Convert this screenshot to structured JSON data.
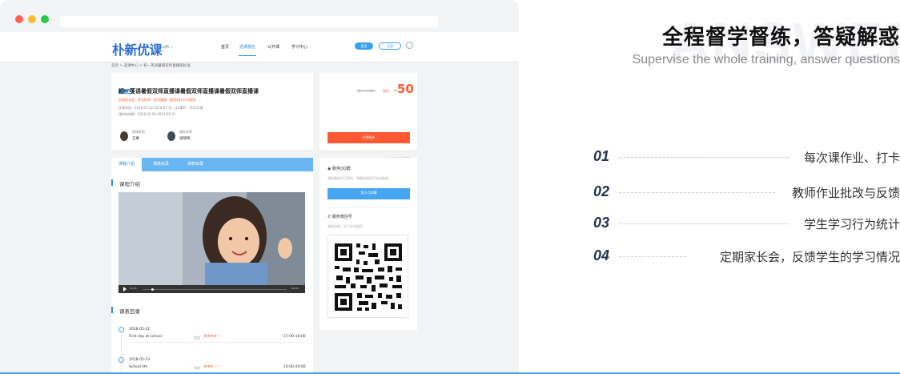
{
  "site": {
    "logo": "朴新优课",
    "city": "山西 ⌄",
    "nav": [
      "首页",
      "选课报名",
      "公开课",
      "学习中心"
    ],
    "login_label": "登录",
    "register_label": "注册",
    "breadcrumb": "首页 > 选课中心 > 初一英语暑假双师直播班标准"
  },
  "course": {
    "tags": [
      "初三",
      "英"
    ],
    "title": "初一英语暑假双师直播课暑假双师直播课暑假双师直播课",
    "features": "定期家长会　考试检测　及时督辅　随堂测(1对1)批改",
    "schedule": "开课时间：2018.07.22-2018.07.31 | 15课时　共33次课",
    "validity": "课程有效期：2018.03.09-2023.08.31",
    "teachers": [
      {
        "role": "授课老师",
        "name": "王惠"
      },
      {
        "role": "辅导老师",
        "name": "张晓明"
      }
    ]
  },
  "pricing": {
    "original": "原价：¥459",
    "special_label": "特价：",
    "price_symbol": "¥",
    "price": "50",
    "limit": "单课时仅3.7元",
    "quota": "限额300 | 剩余235",
    "buy_label": "立即报名"
  },
  "tabs": [
    "课程介绍",
    "课表目录",
    "课表目录"
  ],
  "intro_heading": "课程介绍",
  "video": {
    "current": "00:00",
    "total": "00:00"
  },
  "schedule_heading": "课表目录",
  "lessons": [
    {
      "date": "2018-05-21",
      "name": "First day at school",
      "rate_label": "难度",
      "stars": "★★★★☆",
      "time": "17:00-18:00"
    },
    {
      "date": "2018-05-23",
      "name": "School life",
      "rate_label": "难度",
      "stars": "★★★☆☆",
      "time": "19:00-20:00"
    }
  ],
  "qq": {
    "heading": "服务QQ群",
    "desc": "课程最新学习资料，答疑老师线下加进群组",
    "join_label": "加入QQ群"
  },
  "wechat": {
    "heading": "服务微信号",
    "desc": "课程咨询，学习方法指导"
  },
  "promo": {
    "watermark": "ANSWER",
    "title": "全程督学督练，答疑解惑",
    "subtitle": "Supervise the whole training, answer questions",
    "features": [
      {
        "num": "01",
        "text": "每次课作业、打卡"
      },
      {
        "num": "02",
        "text": "教师作业批改与反馈"
      },
      {
        "num": "03",
        "text": "学生学习行为统计"
      },
      {
        "num": "04",
        "text": "定期家长会，反馈学生的学习情况"
      }
    ]
  },
  "colors": {
    "brand_blue": "#2f8ddb",
    "price_orange": "#ff5a34",
    "feature_num": "#22344f"
  }
}
